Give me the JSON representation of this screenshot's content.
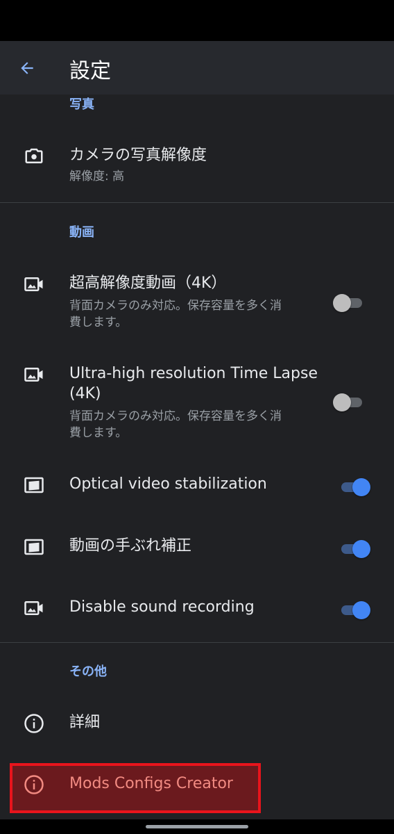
{
  "appbar": {
    "title": "設定"
  },
  "sections": {
    "photo": {
      "header": "写真"
    },
    "video": {
      "header": "動画"
    },
    "other": {
      "header": "その他"
    }
  },
  "items": {
    "photo_resolution": {
      "title": "カメラの写真解像度",
      "subtitle": "解像度: 高",
      "icon": "camera-icon"
    },
    "uhd_video": {
      "title": "超高解像度動画（4K）",
      "subtitle_line1": "背面カメラのみ対応。保存容量を多く消",
      "subtitle_line2": "費します。",
      "icon": "video-icon",
      "enabled": false
    },
    "uhd_timelapse": {
      "title_line1": "Ultra-high resolution Time Lapse",
      "title_line2": "(4K)",
      "subtitle_line1": "背面カメラのみ対応。保存容量を多く消",
      "subtitle_line2": "費します。",
      "icon": "video-icon",
      "enabled": false
    },
    "ois": {
      "title": "Optical video stabilization",
      "icon": "stabilization-icon",
      "enabled": true
    },
    "eis": {
      "title": "動画の手ぶれ補正",
      "icon": "stabilization-icon",
      "enabled": true
    },
    "mute": {
      "title": "Disable sound recording",
      "icon": "video-icon",
      "enabled": true
    },
    "details": {
      "title": "詳細",
      "icon": "info-icon"
    },
    "mods": {
      "title": "Mods Configs Creator",
      "icon": "info-icon"
    }
  },
  "colors": {
    "accent": "#8ab4f8",
    "toggle_on": "#4285f4",
    "highlight_border": "#e8141c",
    "highlight_fill": "#6b1a1e"
  }
}
